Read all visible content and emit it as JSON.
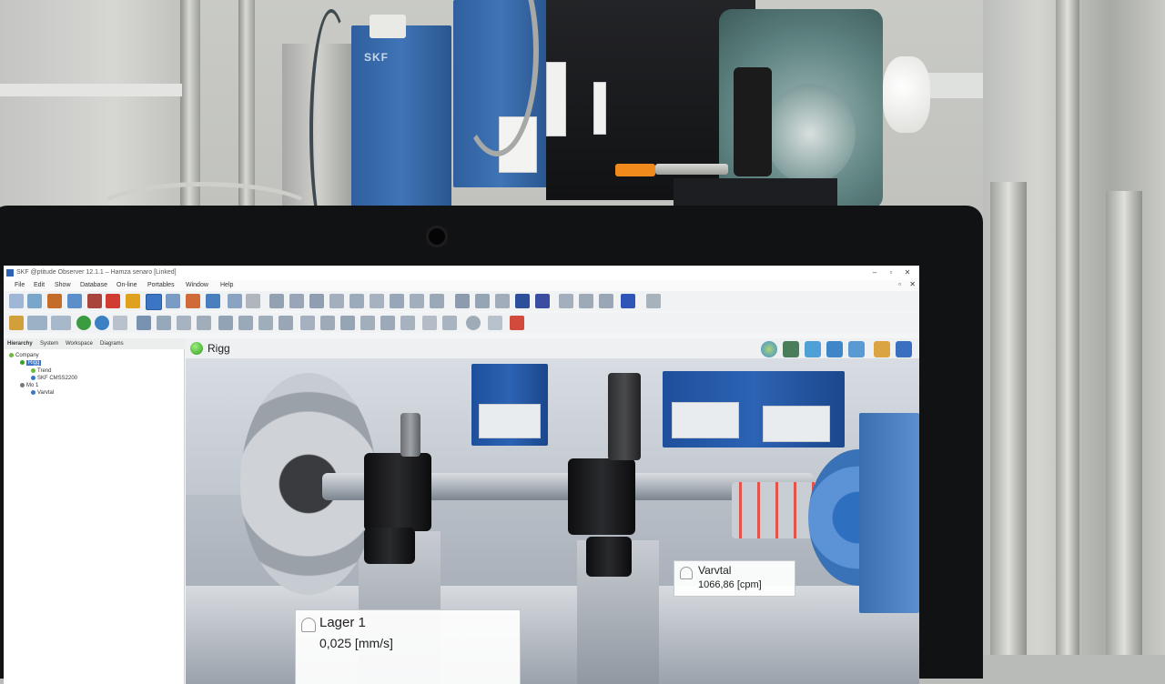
{
  "window": {
    "title": "SKF @ptitude Observer 12.1.1 – Hamza senaro [Linked]",
    "controls": {
      "minimize": "–",
      "maximize": "▫",
      "close": "✕"
    }
  },
  "background": {
    "brand_label": "SKF"
  },
  "menu": {
    "items": [
      "File",
      "Edit",
      "Show",
      "Database",
      "On-line",
      "Portables",
      "Window",
      "Help"
    ]
  },
  "left_panel": {
    "tabs": [
      "Hierarchy",
      "System",
      "Workspace",
      "Diagrams"
    ],
    "tree": [
      {
        "label": "Company",
        "level": 0,
        "status": "#6fb83f"
      },
      {
        "label": "Rigg",
        "level": 1,
        "status": "#37a226",
        "selected": true
      },
      {
        "label": "Trend",
        "level": 2,
        "status": "#6fb83f"
      },
      {
        "label": "SKF CMSS2200",
        "level": 2,
        "status": "#3b75c4"
      },
      {
        "label": "Mo 1",
        "level": 1,
        "status": "#777777"
      },
      {
        "label": "Varvtal",
        "level": 2,
        "status": "#3b75c4"
      }
    ]
  },
  "view": {
    "title": "Rigg",
    "status_color": "#37a226"
  },
  "overlays": {
    "lager1": {
      "name": "Lager 1",
      "value": "0,025 [mm/s]"
    },
    "varvtal": {
      "name": "Varvtal",
      "value": "1066,86 [cpm]"
    }
  },
  "colors": {
    "accent": "#2c63b5",
    "ok": "#37a226",
    "skf_blue": "#3f74b6"
  }
}
